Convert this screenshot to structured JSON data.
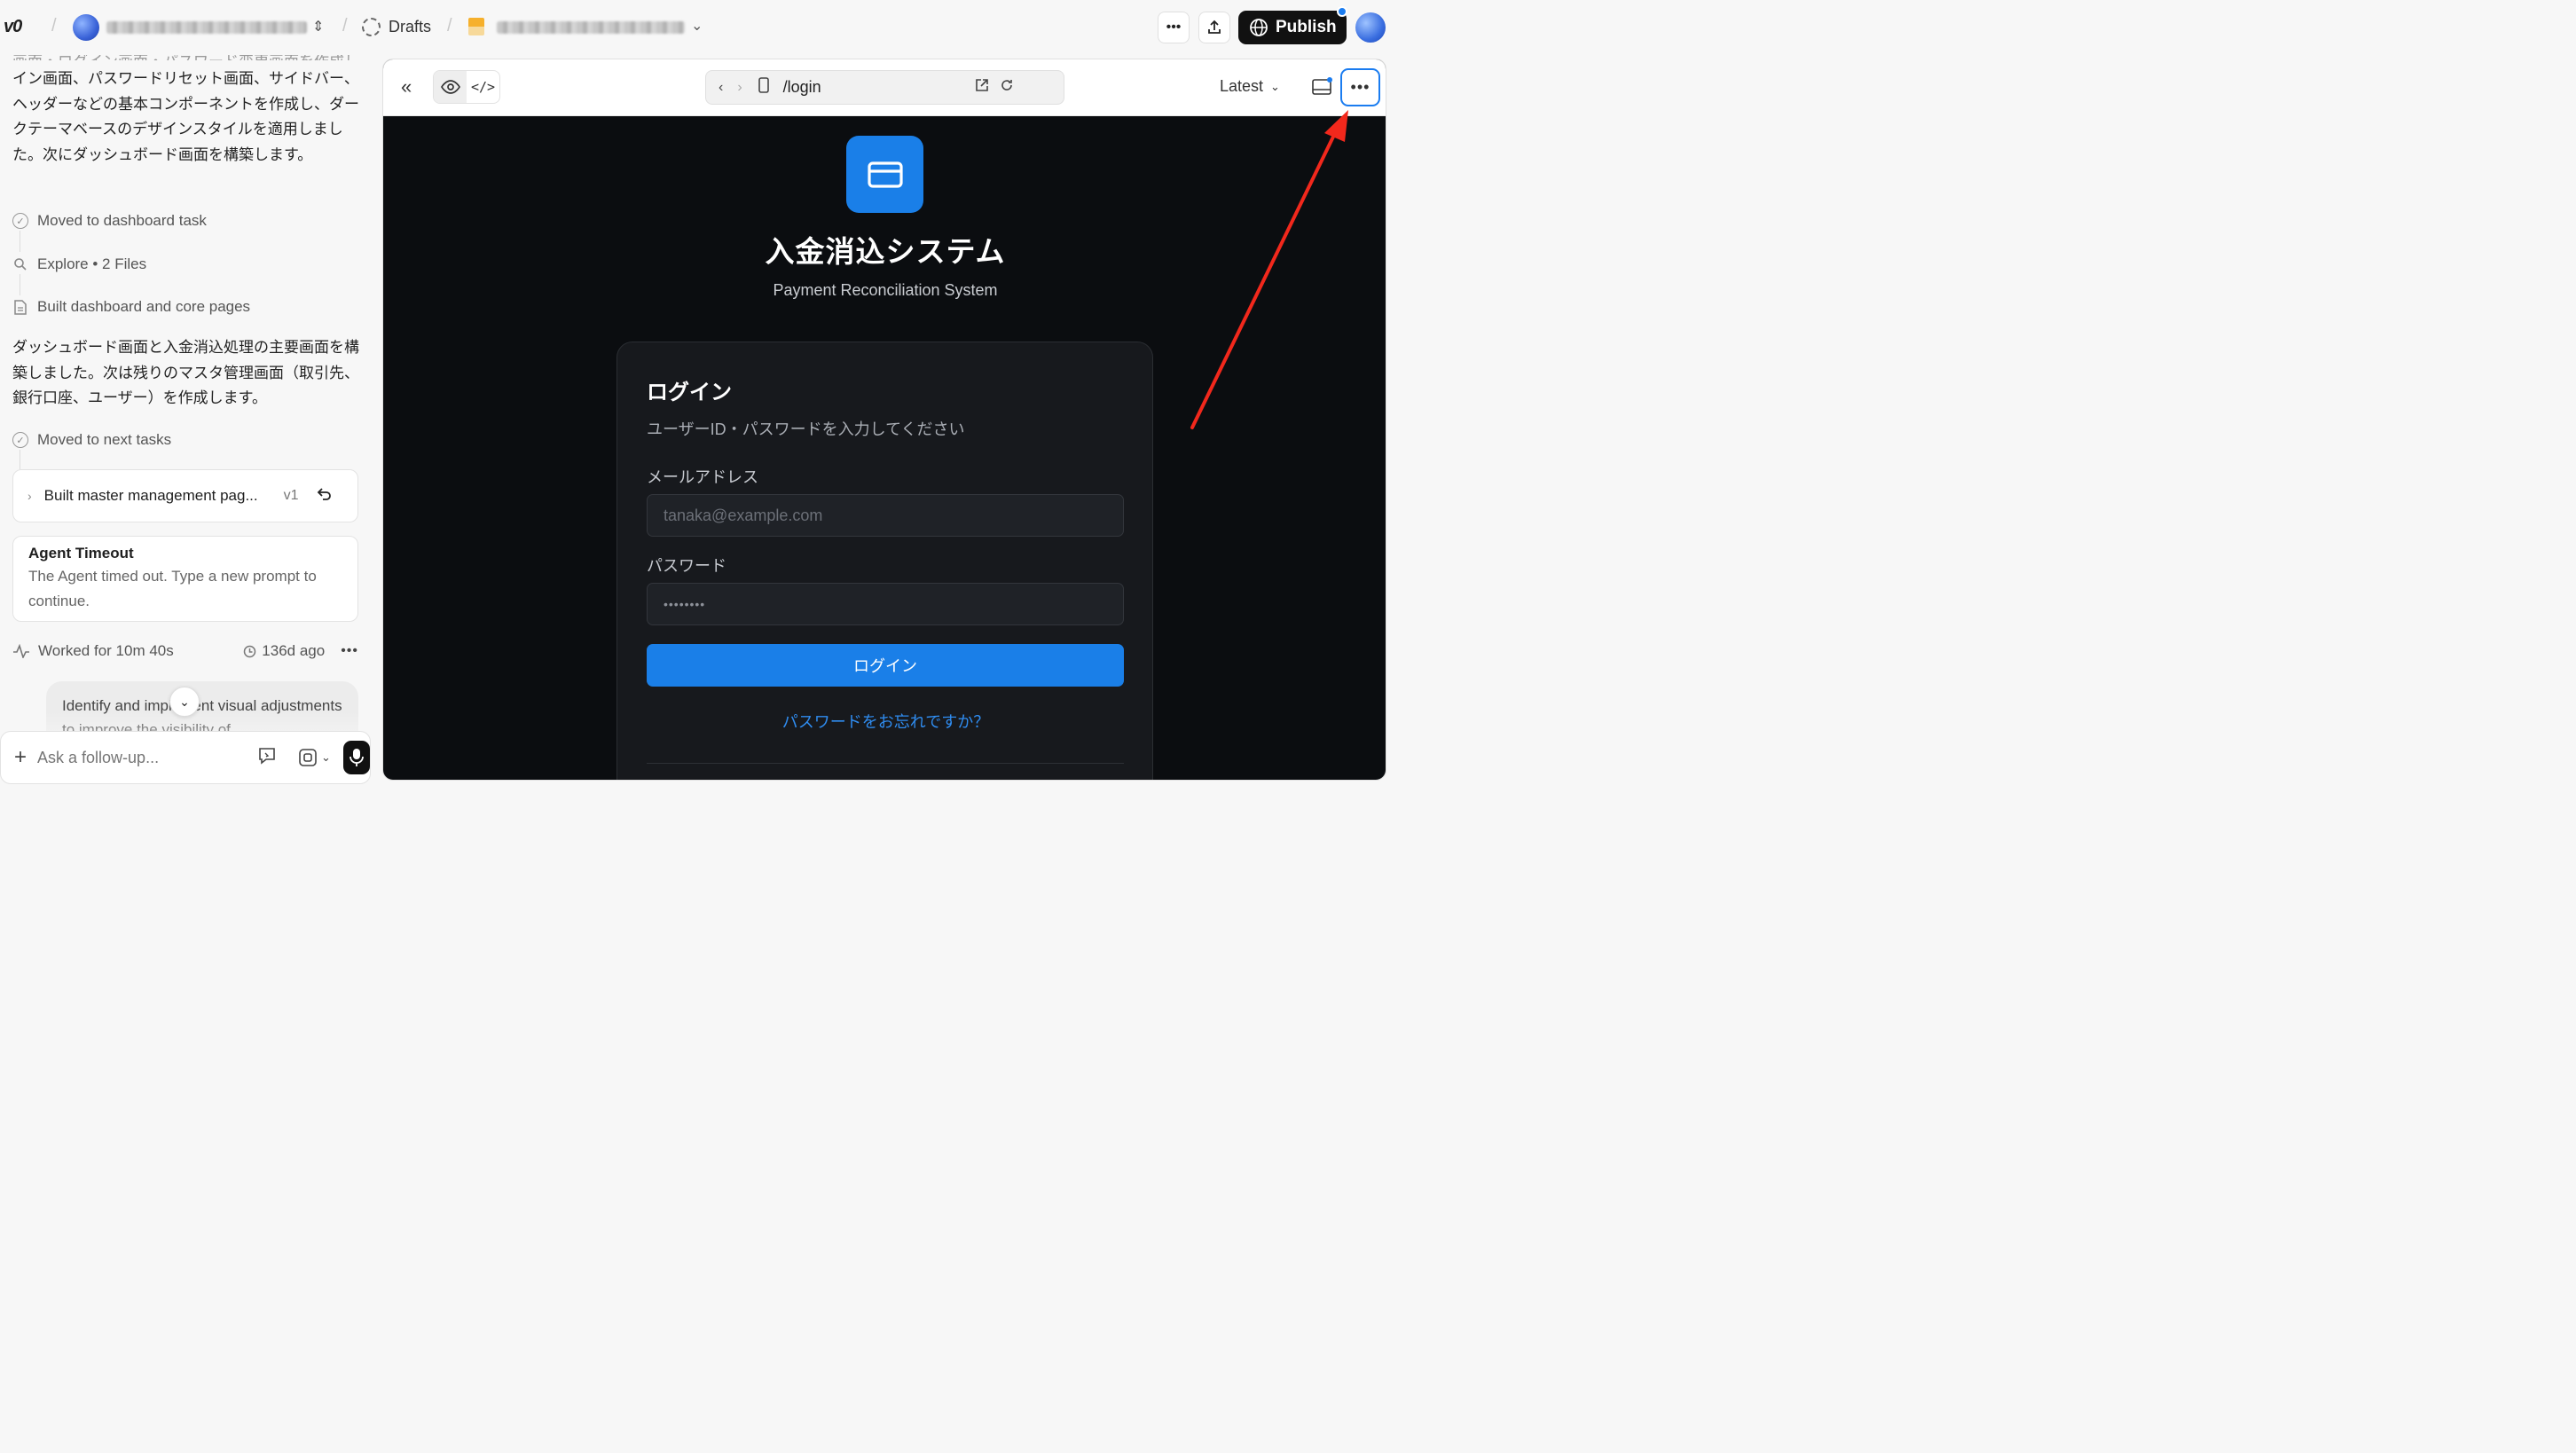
{
  "topbar": {
    "logo_text": "v0",
    "drafts_label": "Drafts",
    "publish_label": "Publish"
  },
  "chat": {
    "intro_text": "イン画面、パスワードリセット画面、サイドバー、ヘッダーなどの基本コンポーネントを作成し、ダークテーマベースのデザインスタイルを適用しました。次にダッシュボード画面を構築します。",
    "steps_a": [
      {
        "icon": "check-circle-icon",
        "label": "Moved to dashboard task"
      },
      {
        "icon": "search-icon",
        "label": "Explore • 2 Files"
      },
      {
        "icon": "file-icon",
        "label": "Built dashboard and core pages"
      }
    ],
    "summary_text": "ダッシュボード画面と入金消込処理の主要画面を構築しました。次は残りのマスタ管理画面（取引先、銀行口座、ユーザー）を作成します。",
    "step_next": "Moved to next tasks",
    "version_card": {
      "title": "Built master management pag...",
      "version": "v1"
    },
    "timeout": {
      "title": "Agent Timeout",
      "body": "The Agent timed out. Type a new prompt to continue."
    },
    "worked": {
      "label": "Worked for 10m 40s",
      "ago": "136d ago"
    },
    "user_bubble": "Identify and implement visual adjustments to improve the visibility of",
    "composer_placeholder": "Ask a follow-up..."
  },
  "preview": {
    "url_path": "/login",
    "version_select": "Latest",
    "app": {
      "title": "入金消込システム",
      "subtitle": "Payment Reconciliation System",
      "card_title": "ログイン",
      "card_desc": "ユーザーID・パスワードを入力してください",
      "email_label": "メールアドレス",
      "email_placeholder": "tanaka@example.com",
      "password_label": "パスワード",
      "password_value": "••••••••",
      "login_button": "ログイン",
      "forgot_link": "パスワードをお忘れですか？"
    }
  },
  "colors": {
    "accent": "#1a7fe8",
    "annotation_arrow": "#f2281c",
    "preview_bg": "#0b0d10"
  }
}
